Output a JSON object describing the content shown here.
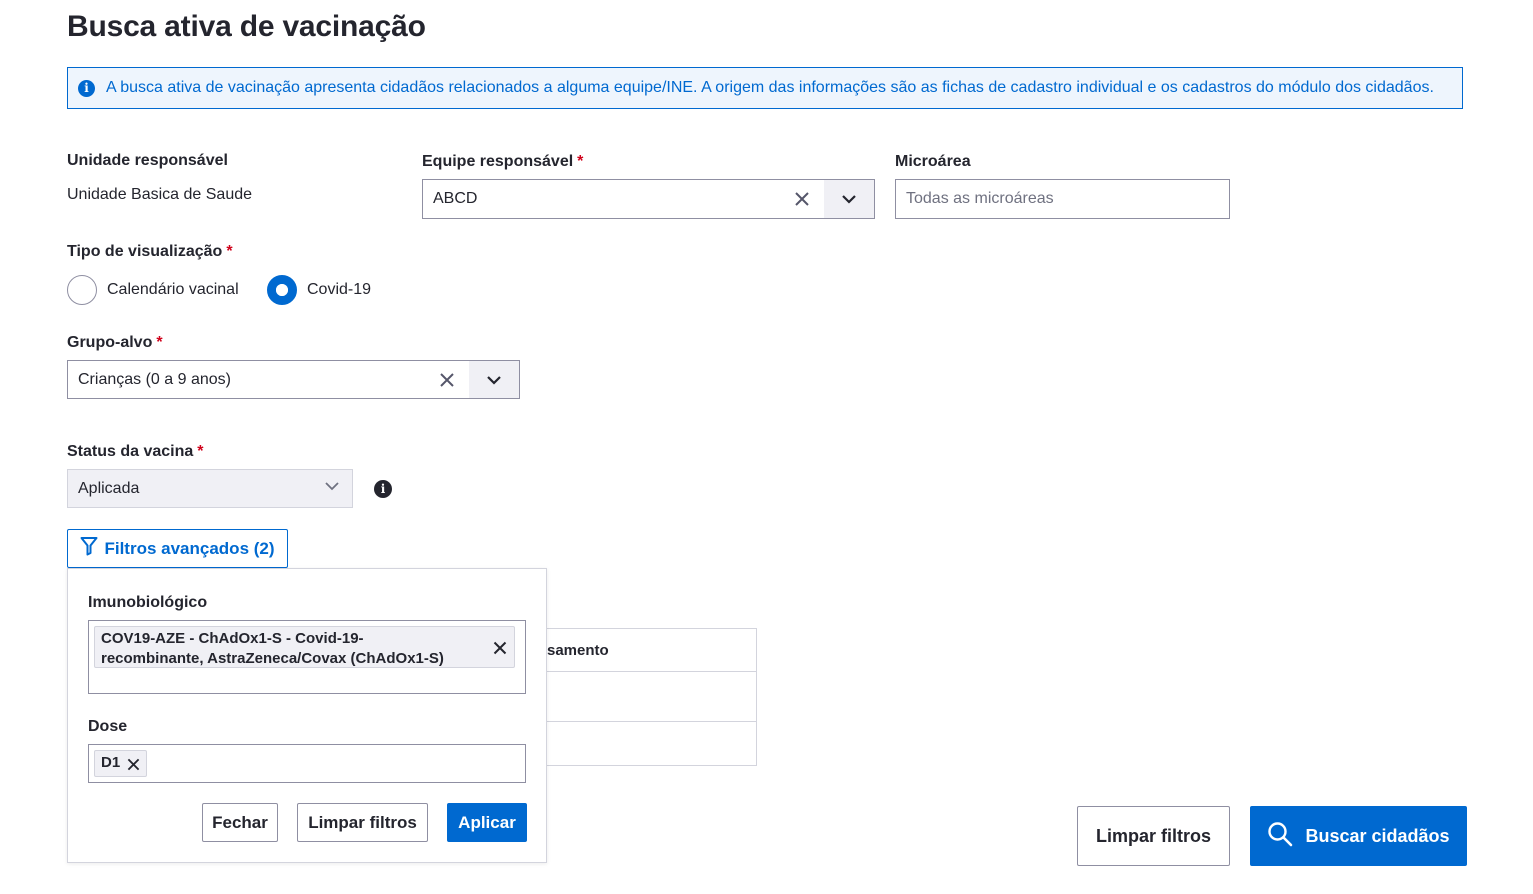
{
  "page": {
    "title": "Busca ativa de vacinação"
  },
  "banner": {
    "text": "A busca ativa de vacinação apresenta cidadãos relacionados a alguma equipe/INE. A origem das informações são as fichas de cadastro individual e os cadastros do módulo dos cidadãos."
  },
  "form": {
    "unidade": {
      "label": "Unidade responsável",
      "value": "Unidade Basica de Saude"
    },
    "equipe": {
      "label": "Equipe responsável",
      "required": "*",
      "value": "ABCD"
    },
    "microarea": {
      "label": "Microárea",
      "placeholder": "Todas as microáreas"
    },
    "tipo": {
      "label": "Tipo de visualização",
      "required": "*",
      "options": [
        "Calendário vacinal",
        "Covid-19"
      ],
      "selected": "Covid-19"
    },
    "grupo": {
      "label": "Grupo-alvo",
      "required": "*",
      "value": "Crianças (0 a 9 anos)"
    },
    "status": {
      "label": "Status da vacina",
      "required": "*",
      "value": "Aplicada"
    },
    "advanced_button": "Filtros avançados (2)"
  },
  "table": {
    "header_fragment": "samento"
  },
  "popover": {
    "imuno": {
      "label": "Imunobiológico",
      "chip_line1": "COV19-AZE - ChAdOx1-S - Covid-19-",
      "chip_line2": "recombinante, AstraZeneca/Covax (ChAdOx1-S)"
    },
    "dose": {
      "label": "Dose",
      "chip": "D1"
    },
    "buttons": {
      "close": "Fechar",
      "clear": "Limpar filtros",
      "apply": "Aplicar"
    }
  },
  "footer": {
    "clear": "Limpar filtros",
    "search": "Buscar cidadãos"
  },
  "colors": {
    "primary": "#0069d0",
    "required": "#d0021b",
    "text": "#24252e",
    "border": "#8f8fa2"
  },
  "icons": [
    "info-icon",
    "close-icon",
    "chevron-down-icon",
    "filter-icon",
    "search-icon"
  ]
}
